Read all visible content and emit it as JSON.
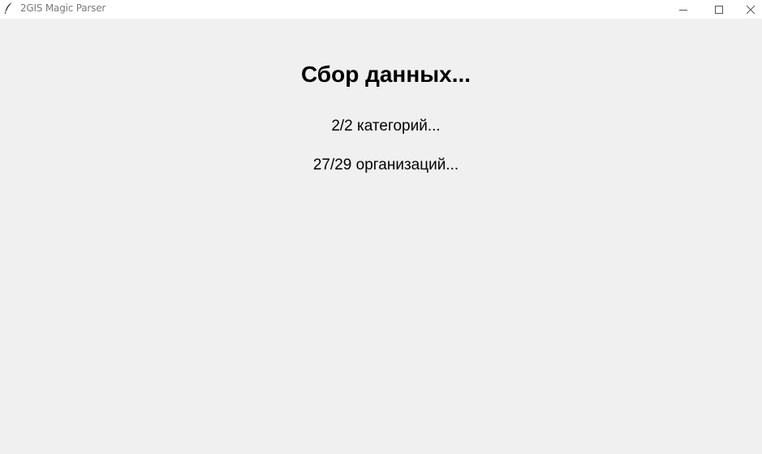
{
  "window": {
    "title": "2GIS Magic Parser",
    "icon": "feather-icon",
    "controls": [
      "minimize-icon",
      "maximize-icon",
      "close-icon"
    ]
  },
  "main": {
    "heading": "Сбор данных...",
    "categories_progress": "2/2 категорий...",
    "organizations_progress": "27/29 организаций..."
  }
}
